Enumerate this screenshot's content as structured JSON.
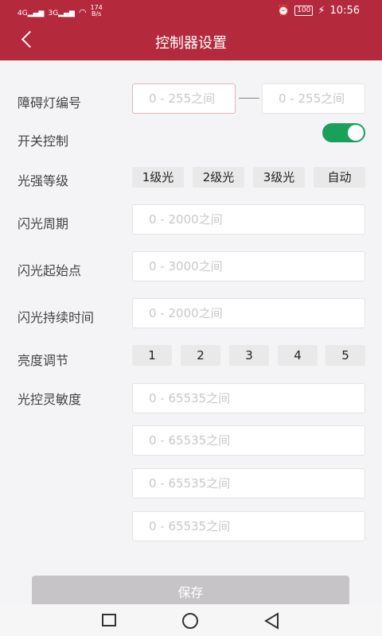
{
  "status_bar": {
    "net1": "4G",
    "net2": "3G",
    "speed_value": "174",
    "speed_unit": "B/s",
    "battery": "100",
    "time": "10:56"
  },
  "header": {
    "title": "控制器设置"
  },
  "form": {
    "obstacle_light_label": "障碍灯编号",
    "obstacle_from_placeholder": "0 - 255之间",
    "obstacle_to_placeholder": "0 - 255之间",
    "switch_label": "开关控制",
    "switch_on": true,
    "light_level_label": "光强等级",
    "light_levels": [
      "1级光",
      "2级光",
      "3级光",
      "自动"
    ],
    "flash_period_label": "闪光周期",
    "flash_period_placeholder": "0 - 2000之间",
    "flash_start_label": "闪光起始点",
    "flash_start_placeholder": "0 - 3000之间",
    "flash_duration_label": "闪光持续时间",
    "flash_duration_placeholder": "0 - 2000之间",
    "brightness_label": "亮度调节",
    "brightness_levels": [
      "1",
      "2",
      "3",
      "4",
      "5"
    ],
    "sensitivity_label": "光控灵敏度",
    "sensitivity_placeholders": [
      "0 - 65535之间",
      "0 - 65535之间",
      "0 - 65535之间",
      "0 - 65535之间"
    ]
  },
  "save_label": "保存",
  "colors": {
    "header": "#b42a3c",
    "toggle_on": "#1aa05a",
    "save_disabled": "#c6c4c7"
  }
}
